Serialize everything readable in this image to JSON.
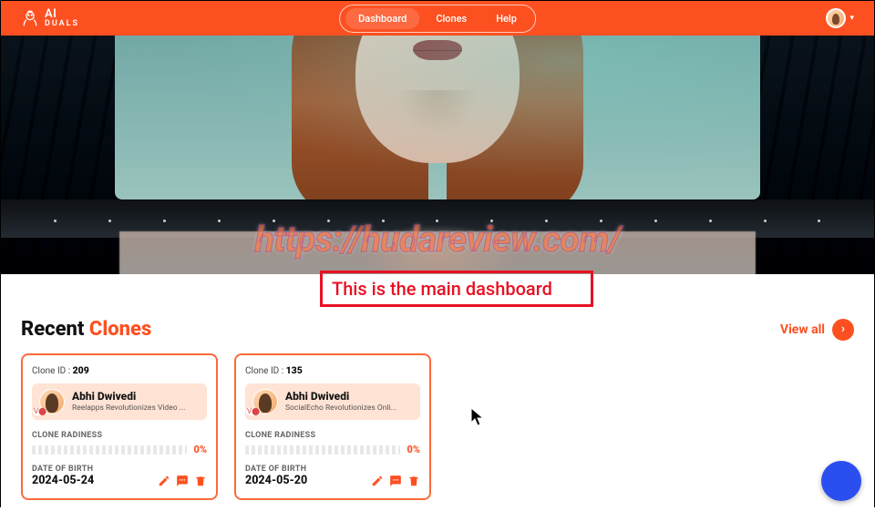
{
  "brand": {
    "name": "AI",
    "sub": "DUALS"
  },
  "nav": {
    "dashboard": "Dashboard",
    "clones": "Clones",
    "help": "Help"
  },
  "watermark": "https://hudareview.com/",
  "annotation": "This is the main dashboard",
  "section": {
    "title_prefix": "Recent ",
    "title_accent": "Clones",
    "viewall": "View all"
  },
  "labels": {
    "clone_id_prefix": "Clone ID : ",
    "readiness": "CLONE RADINESS",
    "dob": "DATE OF BIRTH"
  },
  "cards": [
    {
      "id": "209",
      "user_name": "Abhi Dwivedi",
      "user_sub": "Reelapps Revolutionizes Video ...",
      "progress": "0%",
      "dob": "2024-05-24"
    },
    {
      "id": "135",
      "user_name": "Abhi Dwivedi",
      "user_sub": "SocialEcho Revolutionizes Onli...",
      "progress": "0%",
      "dob": "2024-05-20"
    }
  ]
}
